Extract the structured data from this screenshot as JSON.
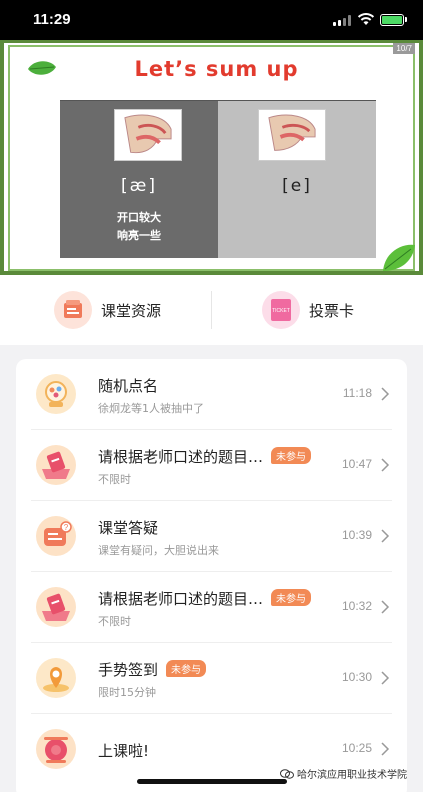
{
  "status_bar": {
    "time": "11:29"
  },
  "slide": {
    "title": "Let’s sum up",
    "badge": "10/7",
    "left_panel": {
      "phonetic": "[æ]",
      "note_line1": "开口较大",
      "note_line2": "响亮一些"
    },
    "right_panel": {
      "phonetic": "[e]"
    }
  },
  "quick_actions": [
    {
      "label": "课堂资源",
      "icon": "classroom-resource-icon",
      "color": "#f07a5a"
    },
    {
      "label": "投票卡",
      "icon": "ticket-icon",
      "icon_text": "TICKET",
      "color": "#f06aa0"
    }
  ],
  "activities": [
    {
      "title": "随机点名",
      "subtitle": "徐炯龙等1人被抽中了",
      "time": "11:18",
      "tag": "",
      "icon": "random-pick-icon"
    },
    {
      "title": "请根据老师口述的题目…",
      "subtitle": "不限时",
      "time": "10:47",
      "tag": "未参与",
      "icon": "vote-card-icon"
    },
    {
      "title": "课堂答疑",
      "subtitle": "课堂有疑问，大胆说出来",
      "time": "10:39",
      "tag": "",
      "icon": "qa-icon"
    },
    {
      "title": "请根据老师口述的题目…",
      "subtitle": "不限时",
      "time": "10:32",
      "tag": "未参与",
      "icon": "vote-card-icon"
    },
    {
      "title": "手势签到",
      "subtitle": "限时15分钟",
      "time": "10:30",
      "tag": "未参与",
      "icon": "gesture-checkin-icon"
    },
    {
      "title": "上课啦!",
      "subtitle": "",
      "time": "10:25",
      "tag": "",
      "icon": "class-bell-icon"
    }
  ],
  "watermark": "哈尔滨应用职业技术学院",
  "colors": {
    "accent_tag": "#f28a55",
    "slide_title": "#e23b2e",
    "slide_border": "#5a8a3a"
  }
}
